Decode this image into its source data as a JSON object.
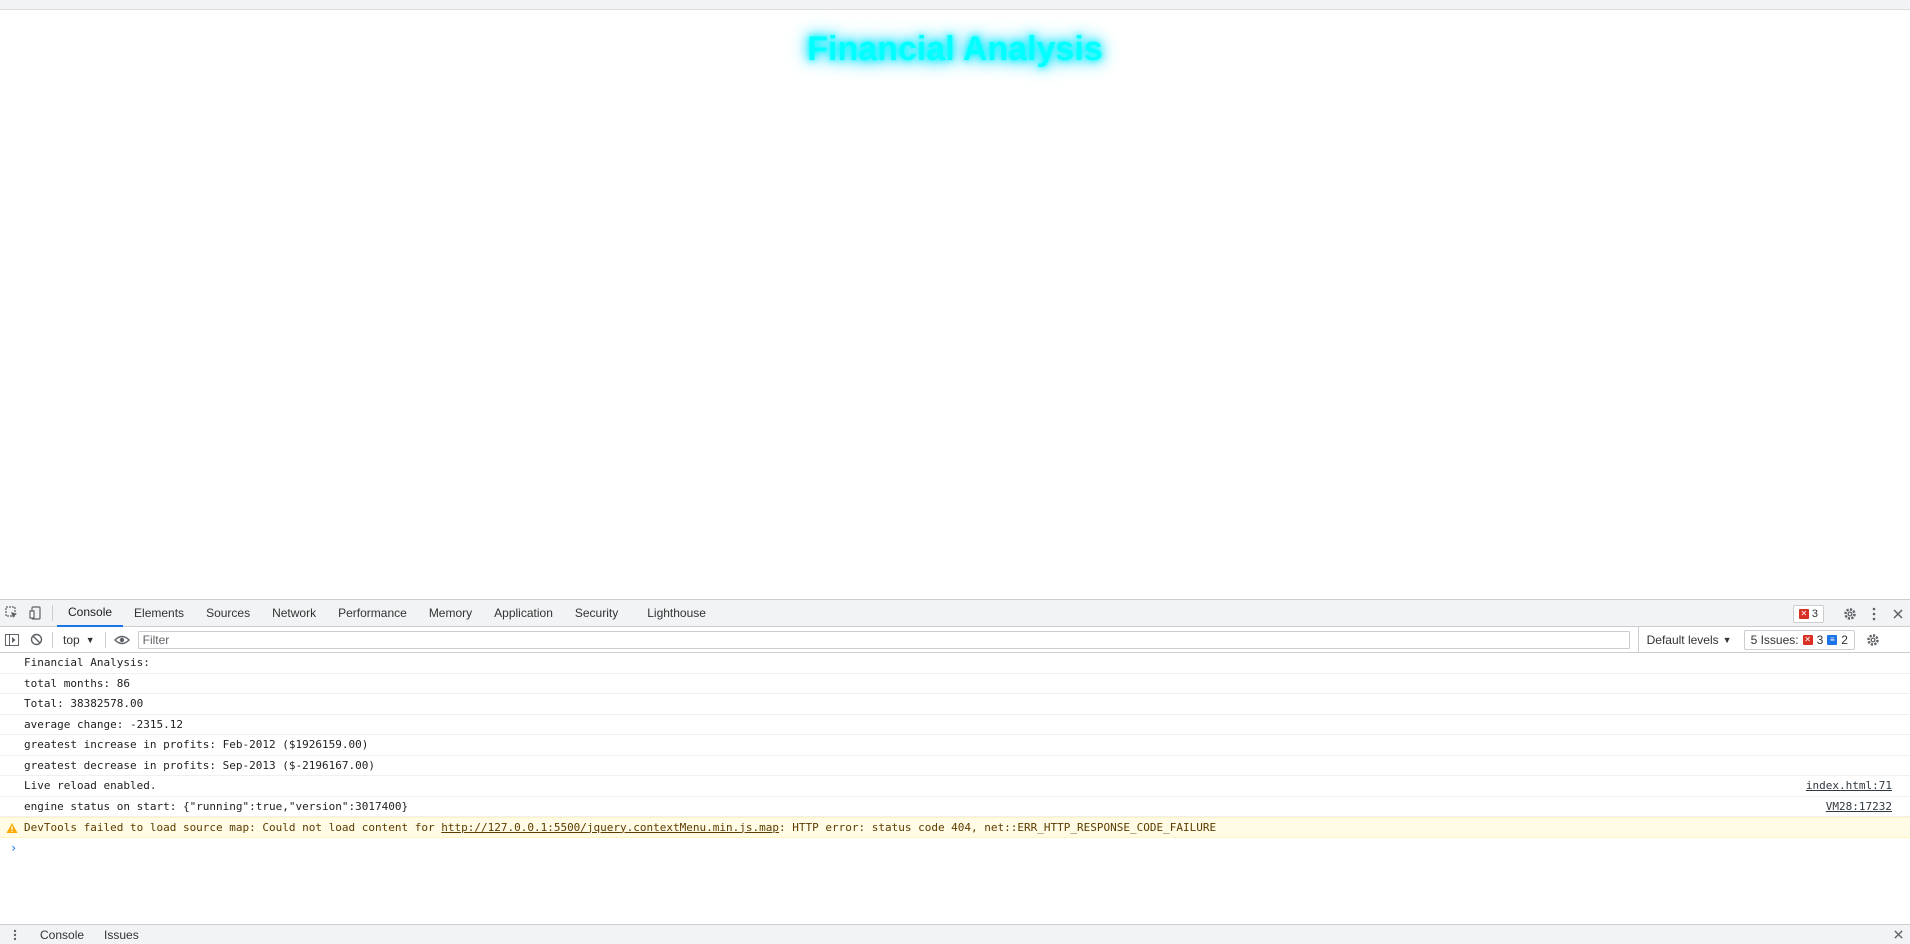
{
  "page": {
    "title": "Financial Analysis",
    "title_color": "#00ffff"
  },
  "devtools": {
    "tabs": [
      {
        "label": "Console",
        "active": true
      },
      {
        "label": "Elements"
      },
      {
        "label": "Sources"
      },
      {
        "label": "Network"
      },
      {
        "label": "Performance"
      },
      {
        "label": "Memory"
      },
      {
        "label": "Application"
      },
      {
        "label": "Security"
      },
      {
        "label": "Lighthouse"
      }
    ],
    "error_count": "3",
    "toolbar": {
      "context": "top",
      "filter_placeholder": "Filter",
      "levels": "Default levels",
      "issues_label": "5 Issues:",
      "issues_errors": "3",
      "issues_info": "2"
    },
    "messages": [
      {
        "text": "Financial Analysis:",
        "source": ""
      },
      {
        "text": "total months: 86",
        "source": ""
      },
      {
        "text": "Total: 38382578.00",
        "source": ""
      },
      {
        "text": "average change: -2315.12",
        "source": ""
      },
      {
        "text": "greatest increase in profits: Feb-2012 ($1926159.00)",
        "source": ""
      },
      {
        "text": "greatest decrease in profits: Sep-2013 ($-2196167.00)",
        "source": ""
      },
      {
        "text": "Live reload enabled.",
        "source": "index.html:71"
      },
      {
        "text": "engine status on start: {\"running\":true,\"version\":3017400}",
        "source": "VM28:17232"
      }
    ],
    "warning": {
      "prefix": "DevTools failed to load source map: Could not load content for ",
      "link": "http://127.0.0.1:5500/jquery.contextMenu.min.js.map",
      "suffix": ": HTTP error: status code 404, net::ERR_HTTP_RESPONSE_CODE_FAILURE"
    },
    "prompt_symbol": "›",
    "drawer_tabs": [
      {
        "label": "Console"
      },
      {
        "label": "Issues"
      }
    ],
    "colors": {
      "accent": "#1a73e8",
      "error": "#d93025",
      "warning_bg": "#fffbe5"
    }
  }
}
